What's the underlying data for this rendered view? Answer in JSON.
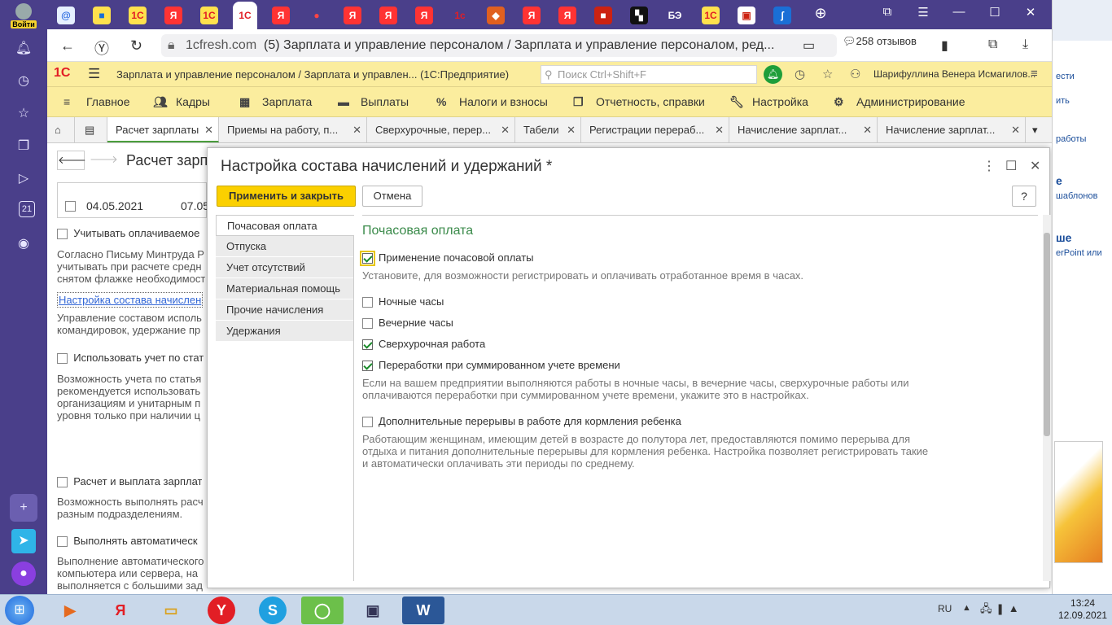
{
  "browser": {
    "login_label": "Войти",
    "url_host": "1cfresh.com",
    "page_title": "(5) Зарплата и управление персоналом / Зарплата и управление персоналом, ред...",
    "reviews": "258 отзывов",
    "sidebar_badge": "21",
    "tabs": [
      {
        "icon": "@",
        "color": "#2a6ae0",
        "bg": "#e6f0ff"
      },
      {
        "icon": "■",
        "color": "#1a6fd6",
        "bg": "#ffe14d"
      },
      {
        "icon": "1С",
        "color": "#e21e25",
        "bg": "#ffe14d"
      },
      {
        "icon": "Я",
        "color": "#fff",
        "bg": "#f33"
      },
      {
        "icon": "1С",
        "color": "#e21e25",
        "bg": "#ffe14d"
      },
      {
        "icon": "1С",
        "color": "#e21e25",
        "bg": "#fff"
      },
      {
        "icon": "Я",
        "color": "#fff",
        "bg": "#f33"
      },
      {
        "icon": "●",
        "color": "#f44",
        "bg": "transparent"
      },
      {
        "icon": "Я",
        "color": "#fff",
        "bg": "#f33"
      },
      {
        "icon": "Я",
        "color": "#fff",
        "bg": "#f33"
      },
      {
        "icon": "Я",
        "color": "#fff",
        "bg": "#f33"
      },
      {
        "icon": "1с",
        "color": "#e21e25",
        "bg": "transparent"
      },
      {
        "icon": "◆",
        "color": "#fff",
        "bg": "#e06020"
      },
      {
        "icon": "Я",
        "color": "#fff",
        "bg": "#f33"
      },
      {
        "icon": "Я",
        "color": "#fff",
        "bg": "#f33"
      },
      {
        "icon": "■",
        "color": "#fff",
        "bg": "#c21"
      },
      {
        "icon": "▚",
        "color": "#fff",
        "bg": "#111"
      },
      {
        "icon": "БЭ",
        "color": "#fff",
        "bg": "#4a3f8a"
      },
      {
        "icon": "1С",
        "color": "#e21e25",
        "bg": "#ffe14d"
      },
      {
        "icon": "▣",
        "color": "#c21",
        "bg": "#fff"
      },
      {
        "icon": "ʃ",
        "color": "#fff",
        "bg": "#1a6fd6"
      }
    ]
  },
  "app": {
    "title": "Зарплата и управление персоналом / Зарплата и управлен...   (1С:Предприятие)",
    "search_placeholder": "Поиск Ctrl+Shift+F",
    "user": "Шарифуллина Венера Исмагилов...",
    "sections": [
      "Главное",
      "Кадры",
      "Зарплата",
      "Выплаты",
      "Налоги и взносы",
      "Отчетность, справки",
      "Настройка",
      "Администрирование"
    ],
    "open_tabs": [
      "Расчет зарплаты",
      "Приемы на работу, п...",
      "Сверхурочные, перер...",
      "Табели",
      "Регистрации перераб...",
      "Начисление зарплат...",
      "Начисление зарплат..."
    ]
  },
  "background_form": {
    "title": "Расчет зарп",
    "date1": "04.05.2021",
    "date2": "07.05",
    "opt1": "Учитывать оплачиваемое",
    "text1": [
      "Согласно Письму Минтруда Р",
      "учитывать при расчете средн",
      "снятом флажке необходимост"
    ],
    "link": "Настройка состава начислен",
    "text2": [
      "Управление составом исполь",
      "командировок, удержание пр"
    ],
    "opt2": "Использовать учет по стат",
    "text3": [
      "Возможность учета по статья",
      "рекомендуется использовать",
      "организациям и унитарным п",
      "уровня только при наличии ц"
    ],
    "opt3": "Расчет и выплата зарплат",
    "text4": [
      "Возможность выполнять расч",
      "разным подразделениям."
    ],
    "opt4": "Выполнять автоматическ",
    "text5": [
      "Выполнение автоматического",
      "компьютера или сервера, на",
      "выполняется с большими зад"
    ]
  },
  "modal": {
    "title": "Настройка состава начислений и удержаний *",
    "apply_label": "Применить и закрыть",
    "cancel_label": "Отмена",
    "help_label": "?",
    "nav": [
      "Почасовая оплата",
      "Отпуска",
      "Учет отсутствий",
      "Материальная помощь",
      "Прочие начисления",
      "Удержания"
    ],
    "section_title": "Почасовая оплата",
    "opt_hourly": {
      "label": "Применение почасовой оплаты",
      "checked": true
    },
    "desc_hourly": "Установите, для возможности регистрировать и оплачивать отработанное время в часах.",
    "opt_night": {
      "label": "Ночные часы",
      "checked": false
    },
    "opt_evening": {
      "label": "Вечерние часы",
      "checked": false
    },
    "opt_overtime": {
      "label": "Сверхурочная работа",
      "checked": true
    },
    "opt_summary": {
      "label": "Переработки при суммированном учете времени",
      "checked": true
    },
    "desc_hours": "Если на вашем предприятии выполняются работы в ночные часы, в вечерние часы, сверхурочные работы или оплачиваются переработки при суммированном учете времени, укажите это в настройках.",
    "opt_breaks": {
      "label": "Дополнительные перерывы в работе для кормления ребенка",
      "checked": false
    },
    "desc_breaks": "Работающим женщинам, имеющим детей в возрасте до полутора лет, предоставляются помимо перерыва для отдыха и питания дополнительные перерывы для кормления ребенка. Настройка позволяет регистрировать такие и автоматически оплачивать эти периоды по среднему."
  },
  "right_app": {
    "lines": [
      "ести",
      "ить",
      "работы",
      "е",
      "шаблонов",
      "ше",
      "erPoint или"
    ]
  },
  "taskbar": {
    "lang": "RU",
    "time": "13:24",
    "date": "12.09.2021"
  }
}
